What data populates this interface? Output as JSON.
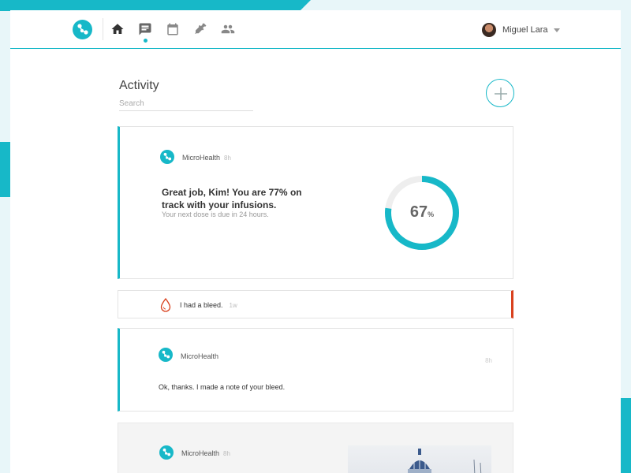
{
  "header": {
    "nav": [
      {
        "name": "home",
        "icon": "home-icon"
      },
      {
        "name": "messages",
        "icon": "chat-icon",
        "active": true
      },
      {
        "name": "calendar",
        "icon": "calendar-icon"
      },
      {
        "name": "log",
        "icon": "syringe-icon"
      },
      {
        "name": "people",
        "icon": "people-icon"
      }
    ],
    "user": {
      "name": "Miguel Lara"
    }
  },
  "activity": {
    "title": "Activity",
    "search_placeholder": "Search"
  },
  "feed": [
    {
      "author": "MicroHealth",
      "time": "8h",
      "headline": "Great job, Kim! You are 77% on track with your infusions.",
      "subline": "Your next dose is due in 24 hours.",
      "progress_value": "67",
      "progress_unit": "%",
      "progress_fraction": 0.77
    },
    {
      "text": "I had a bleed.",
      "time": "1w"
    },
    {
      "author": "MicroHealth",
      "time": "8h",
      "text": "Ok, thanks. I made a note of your bleed."
    },
    {
      "author": "MicroHealth",
      "time": "8h"
    }
  ],
  "colors": {
    "accent": "#17b8c8",
    "alert": "#d9411e"
  }
}
